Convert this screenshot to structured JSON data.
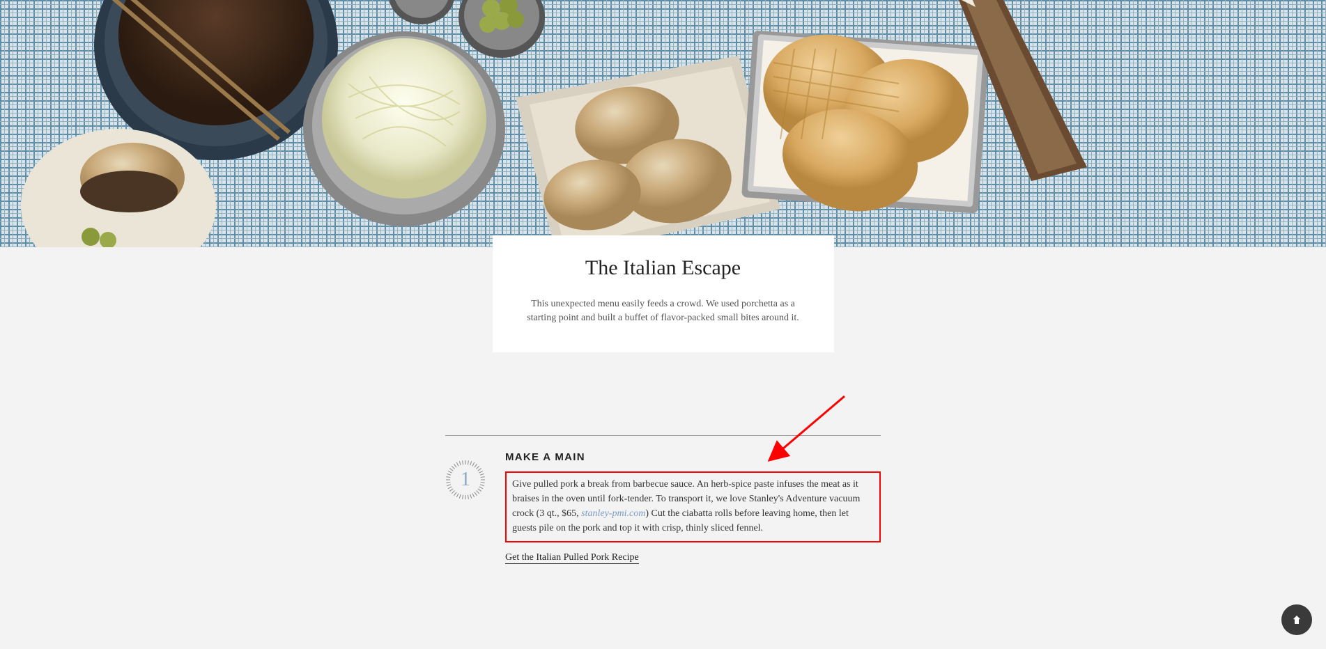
{
  "hero": {
    "title": "The Italian Escape",
    "description": "This unexpected menu easily feeds a crowd. We used porchetta as a starting point and built a buffet of flavor-packed small bites around it."
  },
  "step": {
    "number": "1",
    "heading": "MAKE A MAIN",
    "body_before_link": "Give pulled pork a break from barbecue sauce. An herb-spice paste infuses the meat as it braises in the oven until fork-tender. To transport it, we love Stanley's Adventure vacuum crock (3 qt., $65, ",
    "body_link_text": "stanley-pmi.com",
    "body_after_link": ") Cut the ciabatta rolls before leaving home, then let guests pile on the pork and top it with crisp, thinly sliced fennel.",
    "recipe_link_text": "Get the Italian Pulled Pork Recipe"
  },
  "colors": {
    "annotation": "#ff0000",
    "accent": "#8ba6c4"
  }
}
